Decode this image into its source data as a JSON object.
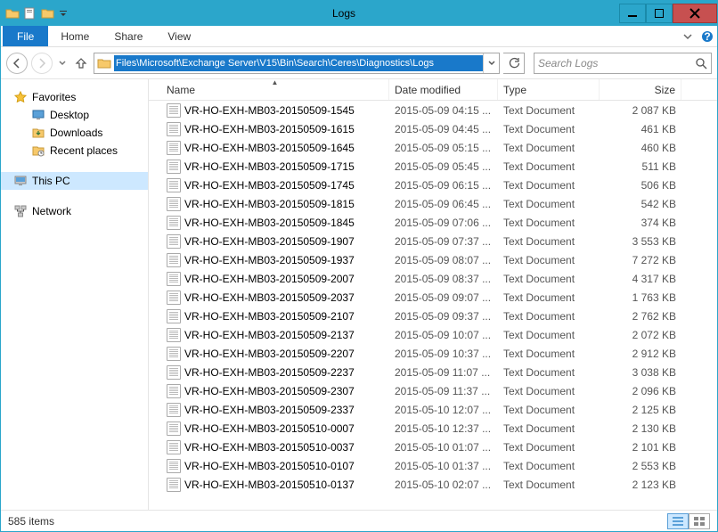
{
  "window": {
    "title": "Logs"
  },
  "ribbon": {
    "file": "File",
    "tabs": [
      "Home",
      "Share",
      "View"
    ]
  },
  "address": {
    "path": "Files\\Microsoft\\Exchange Server\\V15\\Bin\\Search\\Ceres\\Diagnostics\\Logs"
  },
  "search": {
    "placeholder": "Search Logs"
  },
  "sidebar": {
    "favorites": {
      "label": "Favorites",
      "items": [
        {
          "label": "Desktop"
        },
        {
          "label": "Downloads"
        },
        {
          "label": "Recent places"
        }
      ]
    },
    "thispc": {
      "label": "This PC"
    },
    "network": {
      "label": "Network"
    }
  },
  "columns": {
    "name": "Name",
    "date": "Date modified",
    "type": "Type",
    "size": "Size"
  },
  "files": [
    {
      "name": "VR-HO-EXH-MB03-20150509-1545",
      "date": "2015-05-09 04:15 ...",
      "type": "Text Document",
      "size": "2 087 KB"
    },
    {
      "name": "VR-HO-EXH-MB03-20150509-1615",
      "date": "2015-05-09 04:45 ...",
      "type": "Text Document",
      "size": "461 KB"
    },
    {
      "name": "VR-HO-EXH-MB03-20150509-1645",
      "date": "2015-05-09 05:15 ...",
      "type": "Text Document",
      "size": "460 KB"
    },
    {
      "name": "VR-HO-EXH-MB03-20150509-1715",
      "date": "2015-05-09 05:45 ...",
      "type": "Text Document",
      "size": "511 KB"
    },
    {
      "name": "VR-HO-EXH-MB03-20150509-1745",
      "date": "2015-05-09 06:15 ...",
      "type": "Text Document",
      "size": "506 KB"
    },
    {
      "name": "VR-HO-EXH-MB03-20150509-1815",
      "date": "2015-05-09 06:45 ...",
      "type": "Text Document",
      "size": "542 KB"
    },
    {
      "name": "VR-HO-EXH-MB03-20150509-1845",
      "date": "2015-05-09 07:06 ...",
      "type": "Text Document",
      "size": "374 KB"
    },
    {
      "name": "VR-HO-EXH-MB03-20150509-1907",
      "date": "2015-05-09 07:37 ...",
      "type": "Text Document",
      "size": "3 553 KB"
    },
    {
      "name": "VR-HO-EXH-MB03-20150509-1937",
      "date": "2015-05-09 08:07 ...",
      "type": "Text Document",
      "size": "7 272 KB"
    },
    {
      "name": "VR-HO-EXH-MB03-20150509-2007",
      "date": "2015-05-09 08:37 ...",
      "type": "Text Document",
      "size": "4 317 KB"
    },
    {
      "name": "VR-HO-EXH-MB03-20150509-2037",
      "date": "2015-05-09 09:07 ...",
      "type": "Text Document",
      "size": "1 763 KB"
    },
    {
      "name": "VR-HO-EXH-MB03-20150509-2107",
      "date": "2015-05-09 09:37 ...",
      "type": "Text Document",
      "size": "2 762 KB"
    },
    {
      "name": "VR-HO-EXH-MB03-20150509-2137",
      "date": "2015-05-09 10:07 ...",
      "type": "Text Document",
      "size": "2 072 KB"
    },
    {
      "name": "VR-HO-EXH-MB03-20150509-2207",
      "date": "2015-05-09 10:37 ...",
      "type": "Text Document",
      "size": "2 912 KB"
    },
    {
      "name": "VR-HO-EXH-MB03-20150509-2237",
      "date": "2015-05-09 11:07 ...",
      "type": "Text Document",
      "size": "3 038 KB"
    },
    {
      "name": "VR-HO-EXH-MB03-20150509-2307",
      "date": "2015-05-09 11:37 ...",
      "type": "Text Document",
      "size": "2 096 KB"
    },
    {
      "name": "VR-HO-EXH-MB03-20150509-2337",
      "date": "2015-05-10 12:07 ...",
      "type": "Text Document",
      "size": "2 125 KB"
    },
    {
      "name": "VR-HO-EXH-MB03-20150510-0007",
      "date": "2015-05-10 12:37 ...",
      "type": "Text Document",
      "size": "2 130 KB"
    },
    {
      "name": "VR-HO-EXH-MB03-20150510-0037",
      "date": "2015-05-10 01:07 ...",
      "type": "Text Document",
      "size": "2 101 KB"
    },
    {
      "name": "VR-HO-EXH-MB03-20150510-0107",
      "date": "2015-05-10 01:37 ...",
      "type": "Text Document",
      "size": "2 553 KB"
    },
    {
      "name": "VR-HO-EXH-MB03-20150510-0137",
      "date": "2015-05-10 02:07 ...",
      "type": "Text Document",
      "size": "2 123 KB"
    }
  ],
  "status": {
    "count": "585 items"
  }
}
